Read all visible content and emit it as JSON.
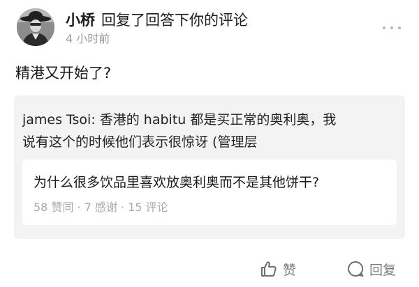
{
  "header": {
    "author_name": "小桥",
    "action_text": "回复了回答下你的评论",
    "time_text": "4 小时前",
    "avatar_icon": "avatar-cowboy-hat-icon",
    "more_icon": "more-dots-icon"
  },
  "reply": {
    "text": "精港又开始了?"
  },
  "quoted_comment": {
    "line1": "james Tsoi: 香港的 habitu 都是买正常的奥利奥，我",
    "line2": "说有这个的时候他们表示很惊讶 (管理层"
  },
  "question": {
    "title": "为什么很多饮品里喜欢放奥利奥而不是其他饼干?",
    "meta": "58 赞同 · 7 感谢 · 15 评论"
  },
  "actions": {
    "like_label": "赞",
    "like_icon": "thumbs-up-icon",
    "reply_label": "回复",
    "reply_icon": "comment-bubble-icon"
  },
  "colors": {
    "text_primary": "#1a1a1a",
    "text_secondary": "#9a9a9a",
    "quote_background": "#f3f3f3",
    "card_background": "#ffffff"
  }
}
